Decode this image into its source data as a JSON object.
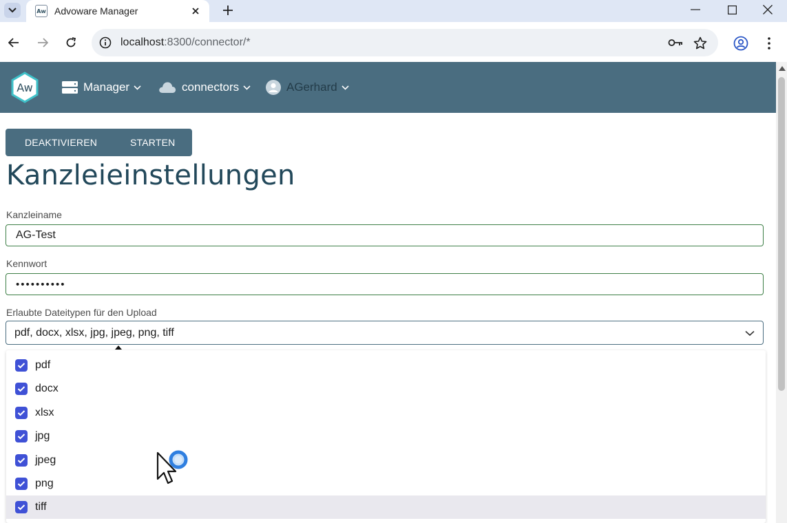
{
  "browser": {
    "tab_title": "Advoware Manager",
    "favicon_text": "Aw",
    "url_host": "localhost",
    "url_path": ":8300/connector/*"
  },
  "nav": {
    "logo_text": "Aw",
    "manager": "Manager",
    "connectors": "connectors",
    "user": "AGerhard"
  },
  "actions": {
    "deactivate": "DEAKTIVIEREN",
    "start": "STARTEN"
  },
  "page": {
    "title": "Kanzleieinstellungen"
  },
  "form": {
    "name_label": "Kanzleiname",
    "name_value": "AG-Test",
    "password_label": "Kennwort",
    "password_value": "••••••••••",
    "filetypes_label": "Erlaubte Dateitypen für den Upload",
    "filetypes_value": "pdf, docx, xlsx, jpg, jpeg, png, tiff"
  },
  "filetype_options": [
    {
      "label": "pdf",
      "checked": true
    },
    {
      "label": "docx",
      "checked": true
    },
    {
      "label": "xlsx",
      "checked": true
    },
    {
      "label": "jpg",
      "checked": true
    },
    {
      "label": "jpeg",
      "checked": true
    },
    {
      "label": "png",
      "checked": true
    },
    {
      "label": "tiff",
      "checked": true,
      "highlighted": true
    }
  ],
  "colors": {
    "nav_bar": "#4a6d80",
    "title": "#22485a",
    "checkbox": "#3f51d6",
    "field_border": "#3d7f46"
  }
}
